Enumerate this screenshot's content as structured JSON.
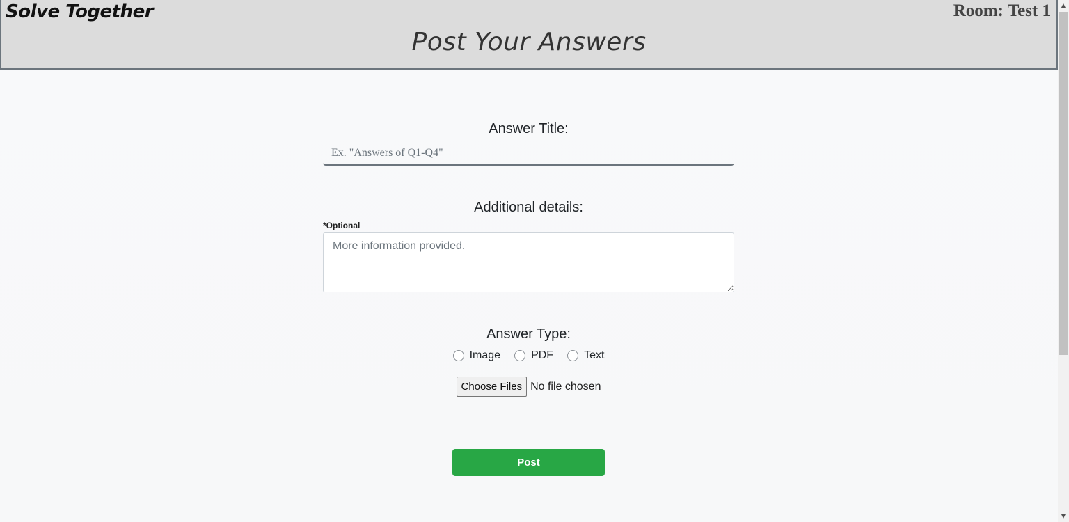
{
  "header": {
    "brand": "Solve Together",
    "room": "Room: Test 1",
    "title": "Post Your Answers"
  },
  "form": {
    "answer_title_label": "Answer Title:",
    "answer_title_placeholder": "Ex. \"Answers of Q1-Q4\"",
    "details_label": "Additional details:",
    "optional_note": "*Optional",
    "details_placeholder": "More information provided.",
    "type_label": "Answer Type:",
    "type_options": [
      "Image",
      "PDF",
      "Text"
    ],
    "choose_files_label": "Choose Files",
    "file_status": "No file chosen",
    "post_label": "Post"
  },
  "colors": {
    "header_bg": "#dcdcdc",
    "post_button": "#28a745",
    "page_bg": "#f8f9fa"
  }
}
